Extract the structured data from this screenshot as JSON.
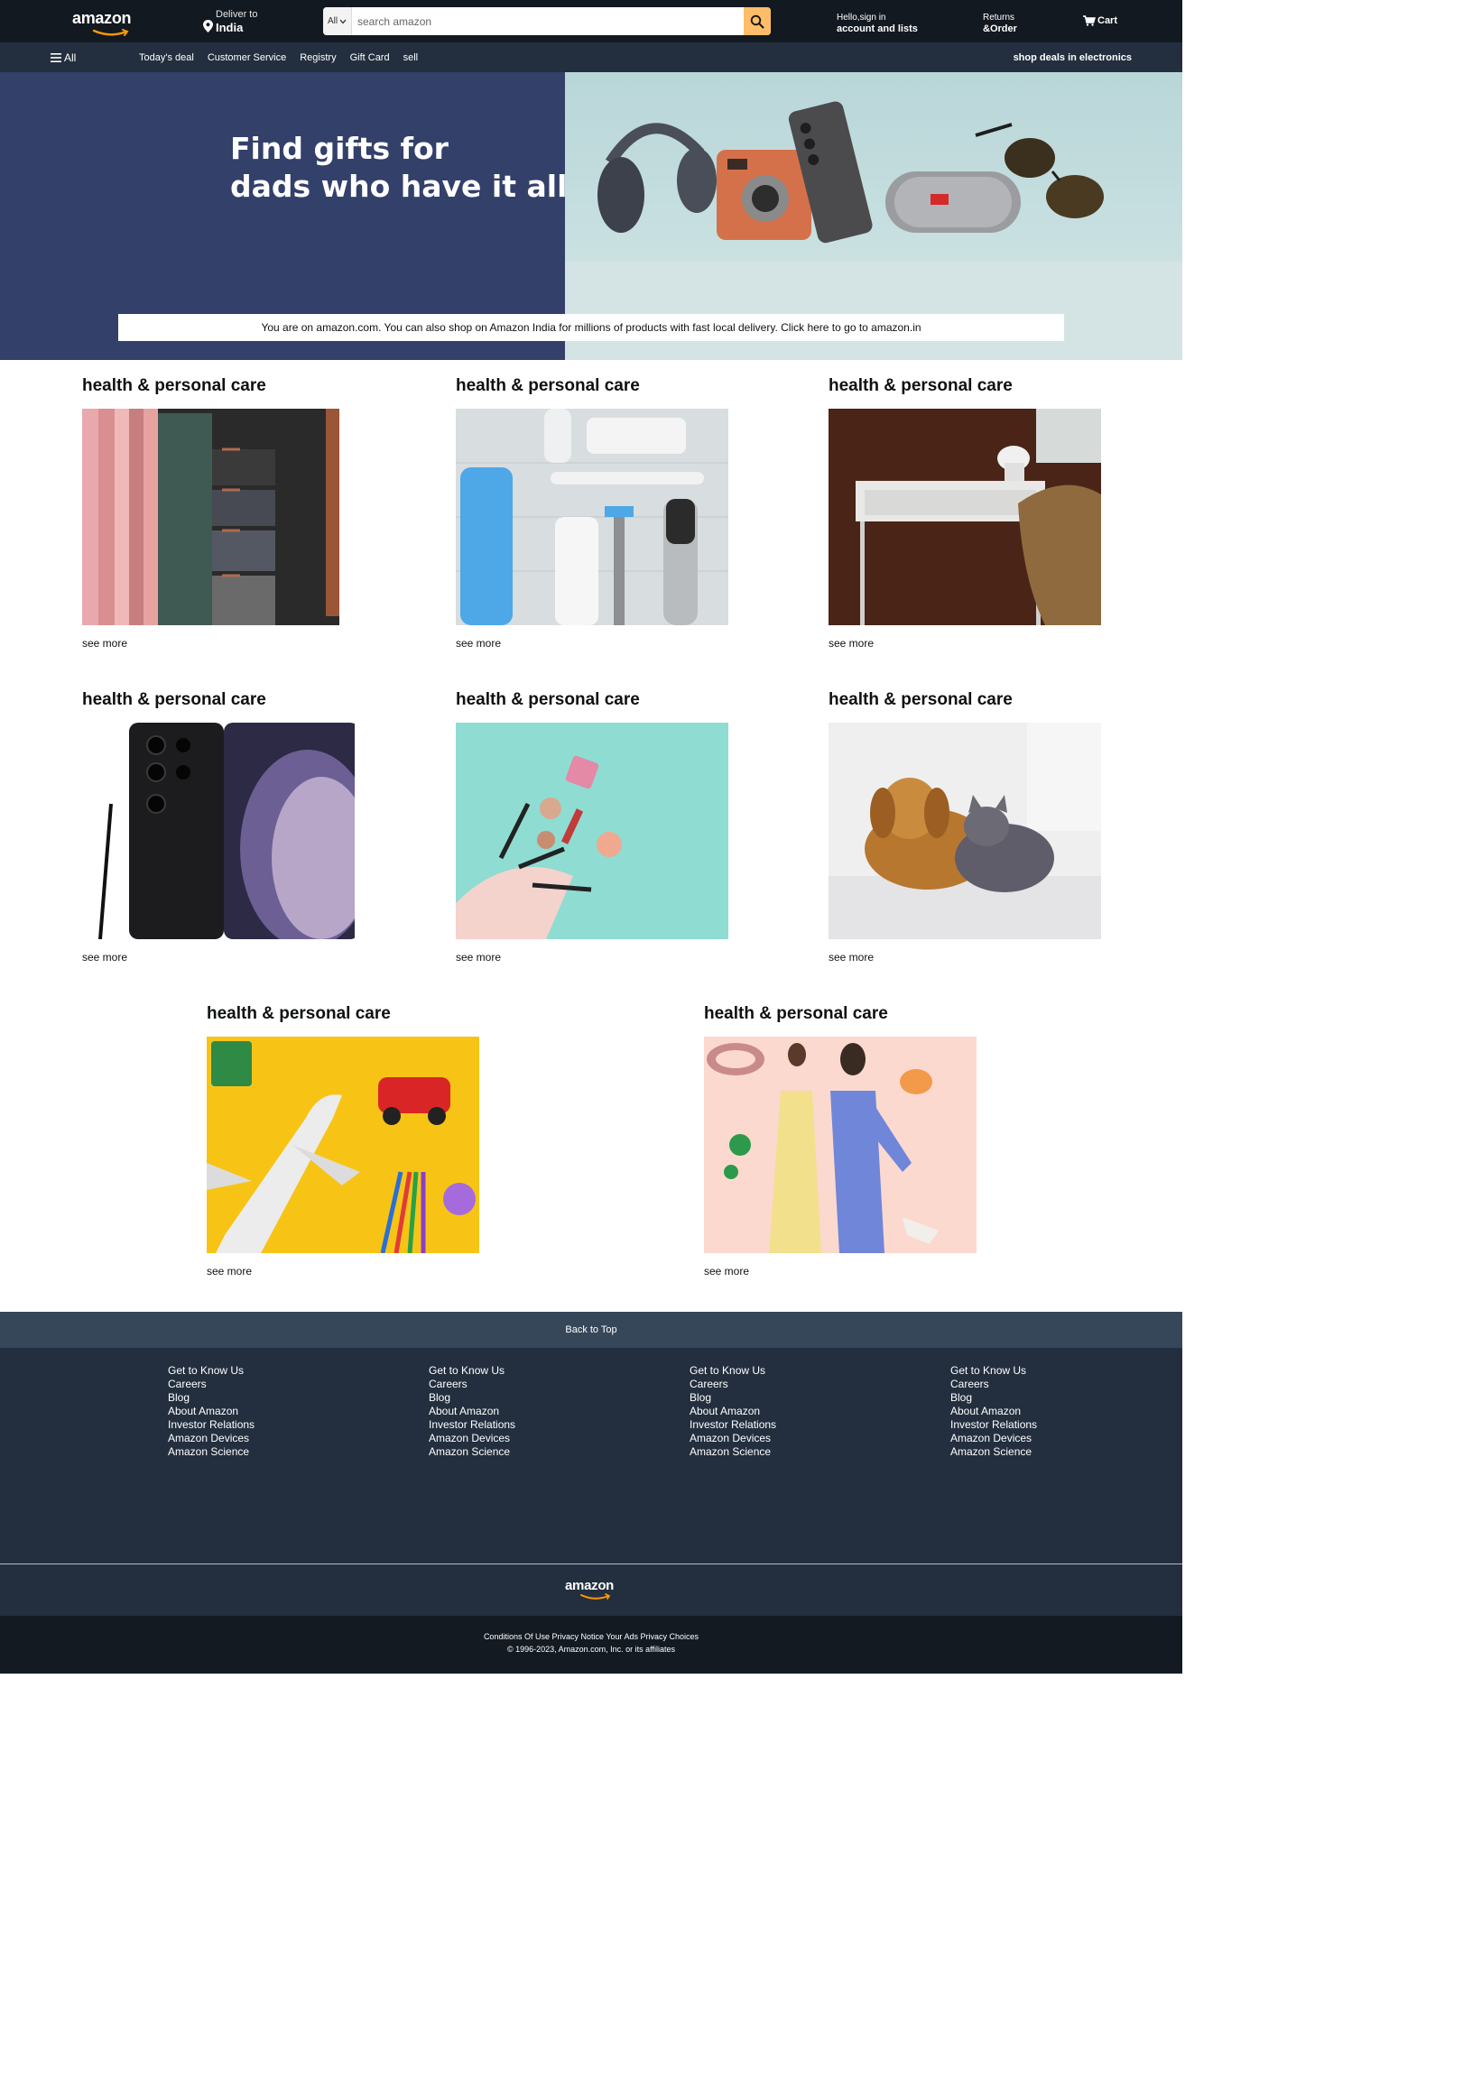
{
  "header": {
    "logo": "amazon",
    "deliver_label": "Deliver to",
    "deliver_location": "India",
    "search_category": "All",
    "search_placeholder": "search amazon",
    "signin_greeting": "Hello,sign in",
    "signin_account": "account and lists",
    "returns_line1": "Returns",
    "returns_line2": "&Order",
    "cart_label": "Cart"
  },
  "nav": {
    "all_label": "All",
    "links": [
      "Today's deal",
      "Customer Service",
      "Registry",
      "Gift Card",
      "sell"
    ],
    "deals_label": "shop deals in electronics"
  },
  "hero": {
    "title_line1": "Find gifts for",
    "title_line2": "dads who have it all",
    "notice": "You are on amazon.com. You can also shop on Amazon India for millions of products with fast local delivery. Click here to go to amazon.in"
  },
  "cards": [
    {
      "title": "health & personal care",
      "link": "see more",
      "image": "scarves-on-hangers"
    },
    {
      "title": "health & personal care",
      "link": "see more",
      "image": "toiletries-flatlay"
    },
    {
      "title": "health & personal care",
      "link": "see more",
      "image": "desk-and-chair"
    },
    {
      "title": "health & personal care",
      "link": "see more",
      "image": "smartphone"
    },
    {
      "title": "health & personal care",
      "link": "see more",
      "image": "makeup-pouch"
    },
    {
      "title": "health & personal care",
      "link": "see more",
      "image": "dog-and-cat"
    },
    {
      "title": "health & personal care",
      "link": "see more",
      "image": "toys-on-yellow"
    },
    {
      "title": "health & personal care",
      "link": "see more",
      "image": "fashion-models"
    }
  ],
  "footer": {
    "back_to_top": "Back to Top",
    "columns": [
      [
        "Get to Know Us",
        "Careers",
        "Blog",
        "About Amazon",
        "Investor Relations",
        "Amazon Devices",
        "Amazon Science"
      ],
      [
        "Get to Know Us",
        "Careers",
        "Blog",
        "About Amazon",
        "Investor Relations",
        "Amazon Devices",
        "Amazon Science"
      ],
      [
        "Get to Know Us",
        "Careers",
        "Blog",
        "About Amazon",
        "Investor Relations",
        "Amazon Devices",
        "Amazon Science"
      ],
      [
        "Get to Know Us",
        "Careers",
        "Blog",
        "About Amazon",
        "Investor Relations",
        "Amazon Devices",
        "Amazon Science"
      ]
    ],
    "logo": "amazon",
    "legal_links": "Conditions Of Use Privacy Notice Your Ads Privacy Choices",
    "copyright": "© 1996-2023, Amazon.com, Inc. or its affiliates"
  },
  "colors": {
    "header_bg": "#131921",
    "nav_bg": "#232f3e",
    "search_button": "#febd69",
    "hero_left": "#33406a",
    "back_to_top_bg": "#37475a",
    "footer_bg": "#232f3e",
    "bottom_bg": "#131a22"
  },
  "icons": [
    "location-pin-icon",
    "chevron-down-icon",
    "search-icon",
    "cart-icon",
    "hamburger-menu-icon"
  ]
}
